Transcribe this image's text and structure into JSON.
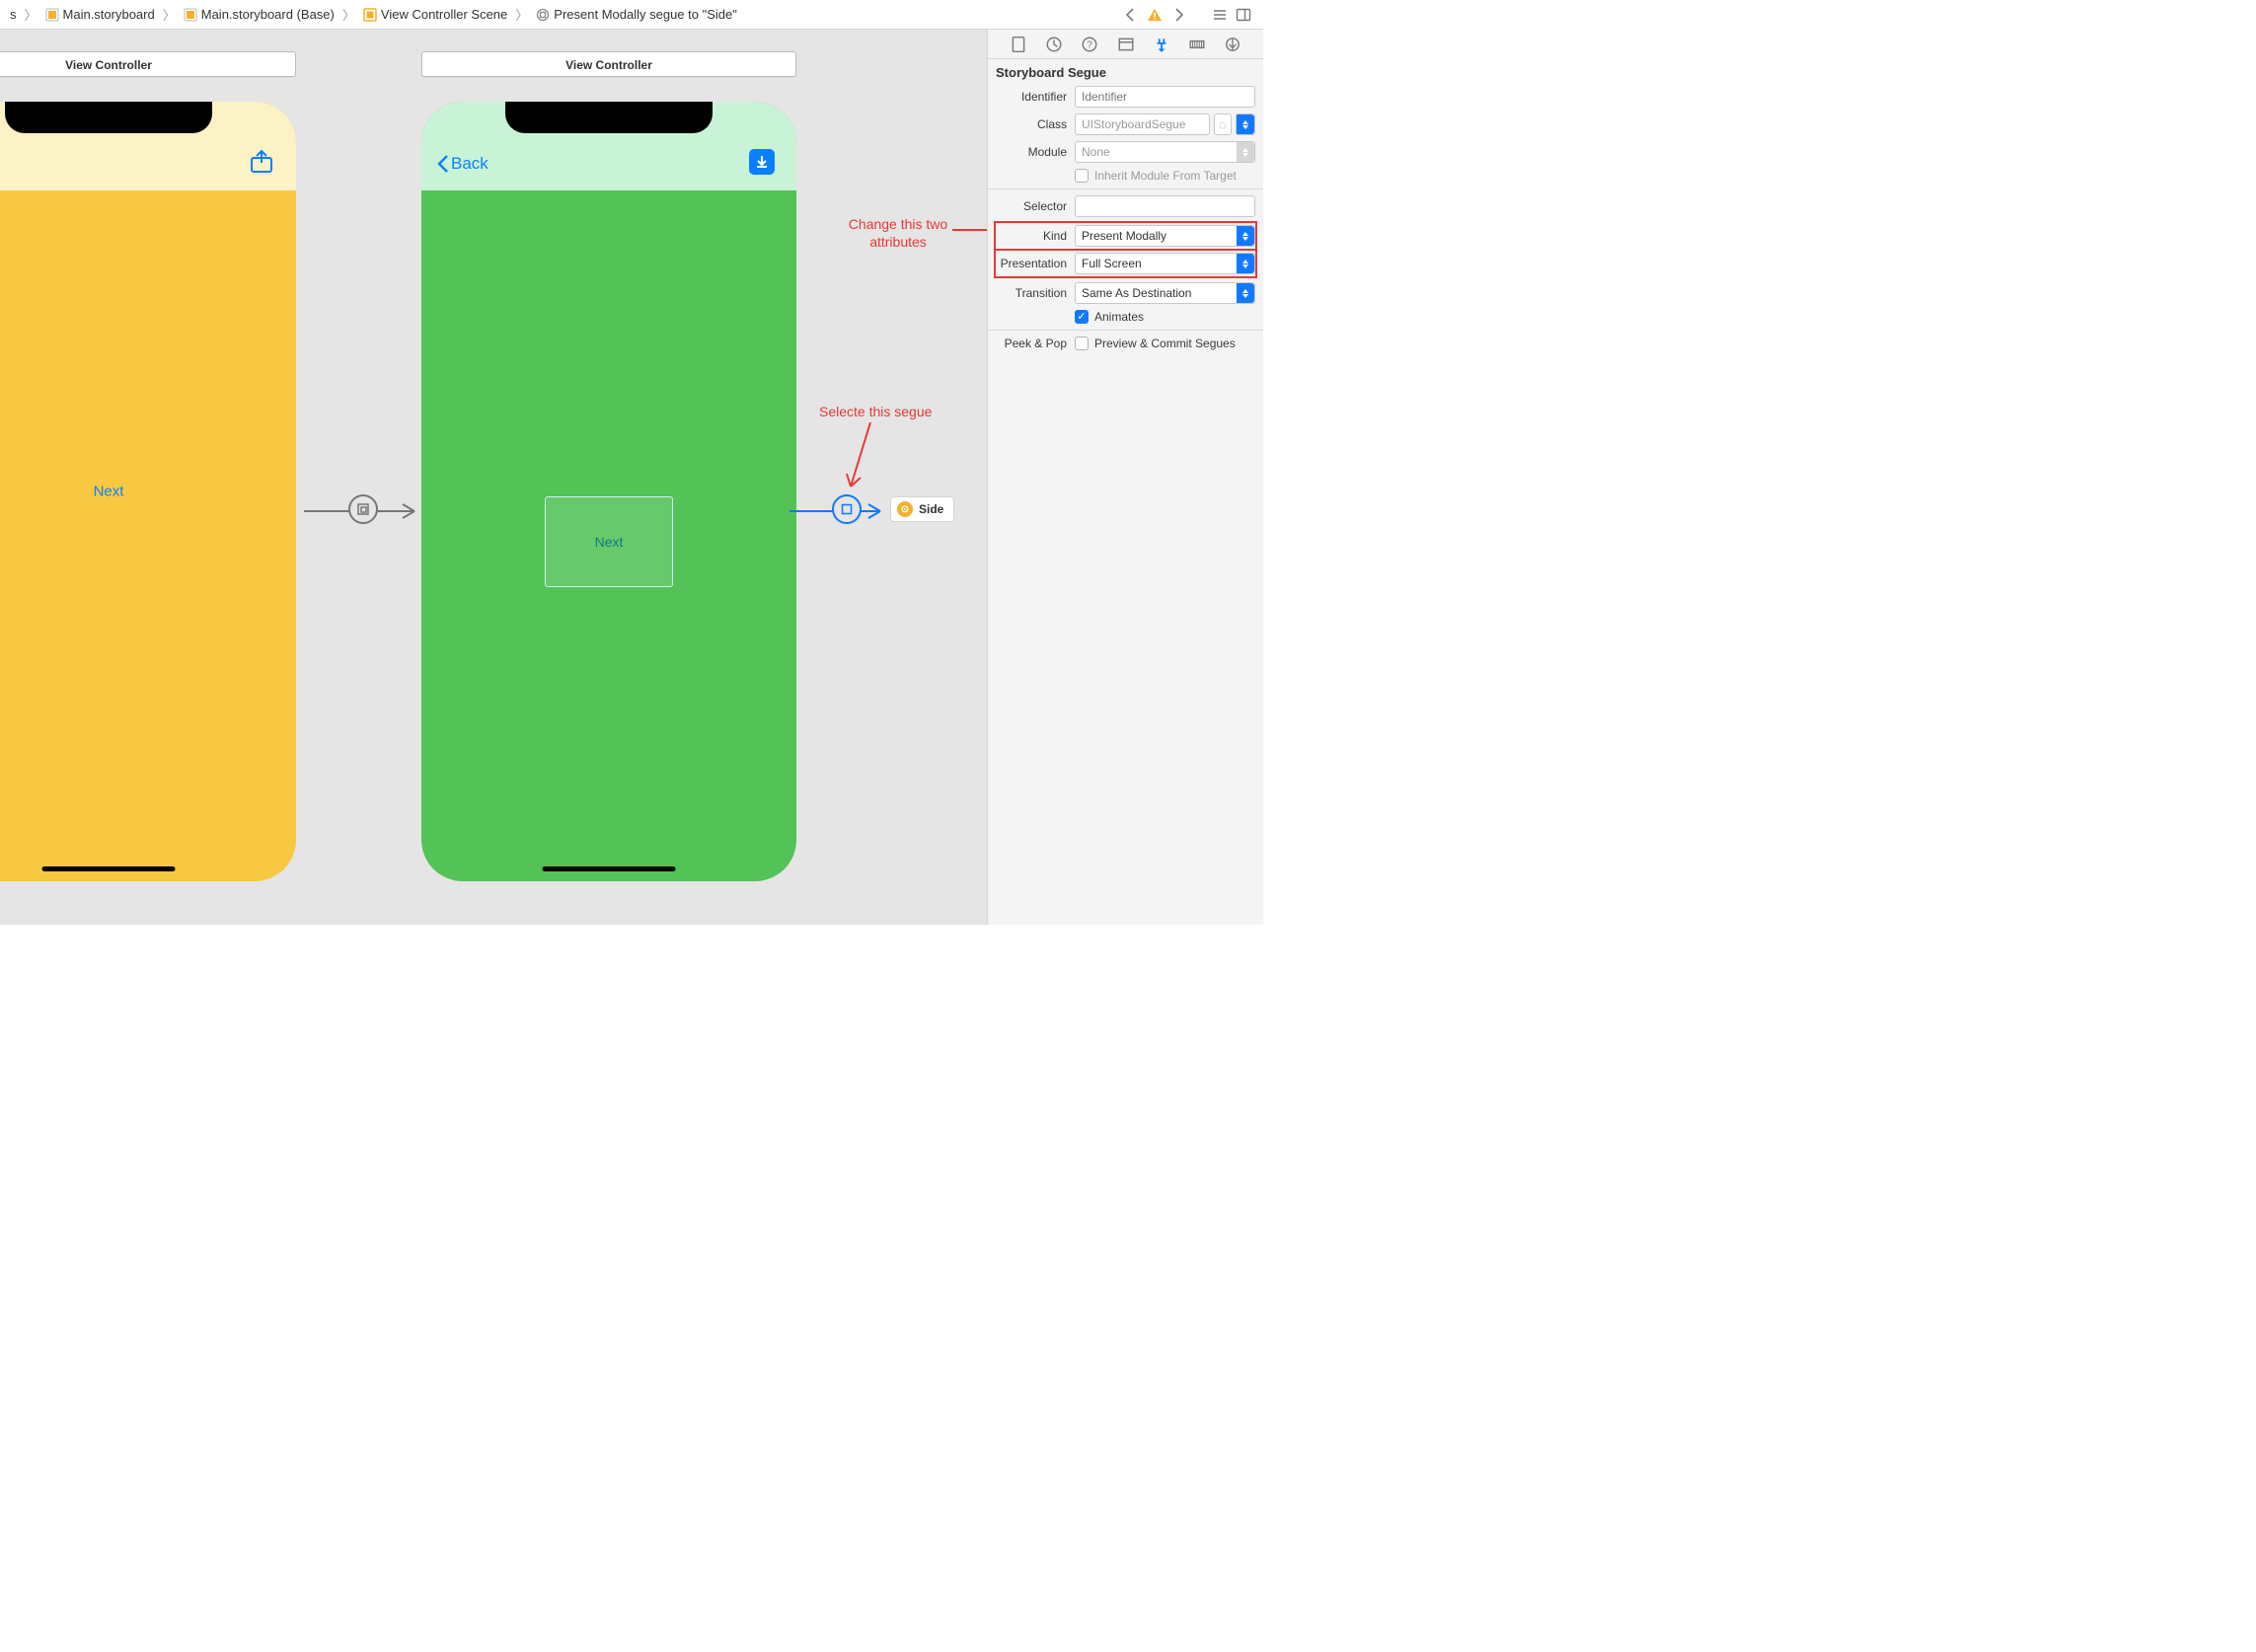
{
  "breadcrumbs": {
    "b0_trunc": "s",
    "b1": "Main.storyboard",
    "b2": "Main.storyboard (Base)",
    "b3": "View Controller Scene",
    "b4": "Present Modally segue to \"Side\""
  },
  "view_controllers": {
    "left": {
      "title": "View Controller",
      "next_label": "Next"
    },
    "right": {
      "title": "View Controller",
      "back_label": "Back",
      "container_label": "Next"
    }
  },
  "side_ref": {
    "label": "Side"
  },
  "annotations": {
    "change_attrs": "Change this two\nattributes",
    "select_segue": "Selecte this segue"
  },
  "inspector": {
    "section": "Storyboard Segue",
    "identifier_label": "Identifier",
    "identifier_placeholder": "Identifier",
    "class_label": "Class",
    "class_value": "UIStoryboardSegue",
    "module_label": "Module",
    "module_value": "None",
    "inherit_label": "Inherit Module From Target",
    "selector_label": "Selector",
    "kind_label": "Kind",
    "kind_value": "Present Modally",
    "presentation_label": "Presentation",
    "presentation_value": "Full Screen",
    "transition_label": "Transition",
    "transition_value": "Same As Destination",
    "animates_label": "Animates",
    "peek_label": "Peek & Pop",
    "peek_value": "Preview & Commit Segues"
  }
}
